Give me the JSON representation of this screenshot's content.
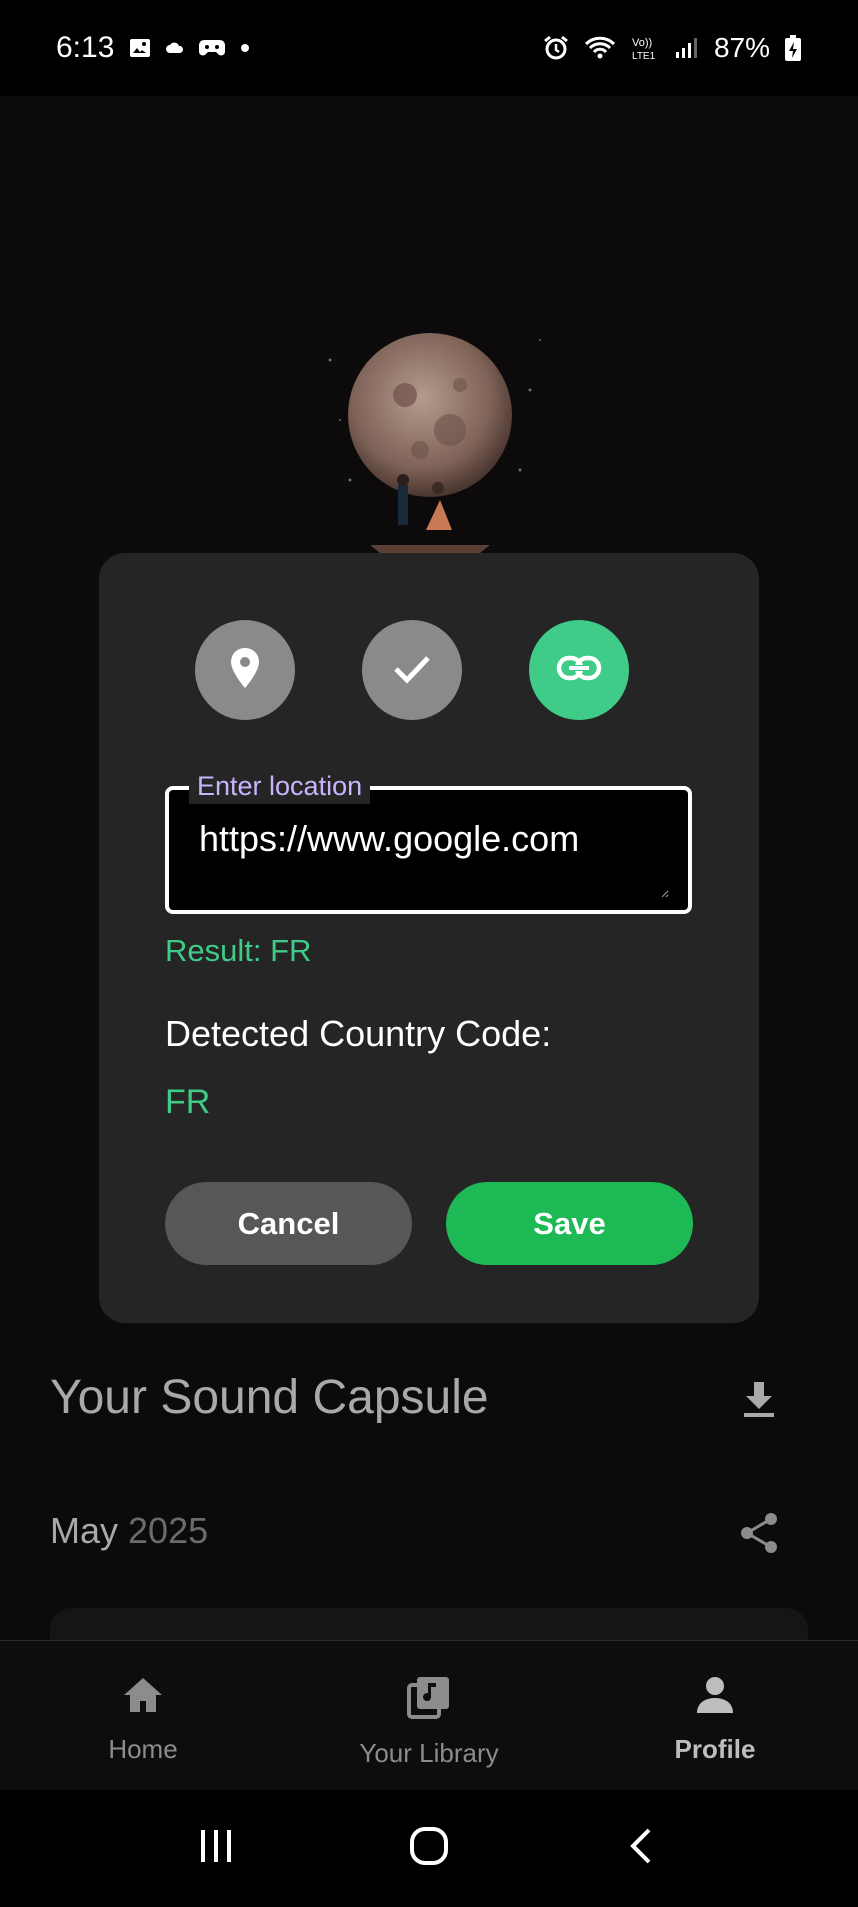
{
  "status_bar": {
    "time": "6:13",
    "battery": "87%",
    "icons_left": [
      "gallery-icon",
      "cloud-icon",
      "game-controller-icon",
      "dot-icon"
    ],
    "icons_right": [
      "alarm-icon",
      "wifi-icon",
      "volte-icon",
      "signal-icon",
      "battery-charging-icon"
    ]
  },
  "dialog": {
    "mode_buttons": [
      {
        "icon": "location-pin-icon",
        "active": false
      },
      {
        "icon": "check-icon",
        "active": false
      },
      {
        "icon": "link-icon",
        "active": true
      }
    ],
    "input": {
      "label": "Enter location",
      "value": "https://www.google.com"
    },
    "result_text": "Result: FR",
    "detected_label": "Detected Country Code:",
    "detected_code": "FR",
    "cancel_label": "Cancel",
    "save_label": "Save"
  },
  "background": {
    "capsule_title": "Your Sound Capsule",
    "month": "May",
    "year": "2025"
  },
  "bottom_nav": {
    "items": [
      {
        "label": "Home",
        "icon": "home-icon",
        "active": false
      },
      {
        "label": "Your Library",
        "icon": "library-icon",
        "active": false
      },
      {
        "label": "Profile",
        "icon": "profile-icon",
        "active": true
      }
    ]
  },
  "colors": {
    "accent_green": "#3fcb88",
    "save_green": "#1db954",
    "label_purple": "#c9b3ff",
    "dialog_bg": "#252525"
  }
}
